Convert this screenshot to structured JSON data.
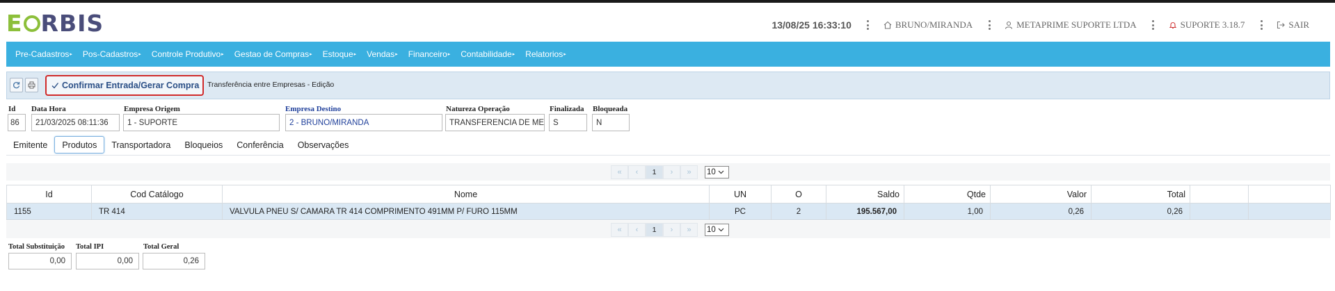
{
  "brand": {
    "logo_text": "EORBIS"
  },
  "header": {
    "datetime": "13/08/25 16:33:10",
    "branch": "BRUNO/MIRANDA",
    "company": "METAPRIME SUPORTE LTDA",
    "support": "SUPORTE 3.18.7",
    "logout": "SAIR"
  },
  "menu": [
    "Pre-Cadastros",
    "Pos-Cadastros",
    "Controle Produtivo",
    "Gestao de Compras",
    "Estoque",
    "Vendas",
    "Financeiro",
    "Contabilidade",
    "Relatorios"
  ],
  "toolbar": {
    "confirm_label": "Confirmar Entrada/Gerar Compra",
    "title": "Transferência entre Empresas - Edição"
  },
  "form": {
    "id": {
      "label": "Id",
      "value": "86"
    },
    "data_hora": {
      "label": "Data Hora",
      "value": "21/03/2025 08:11:36"
    },
    "empresa_origem": {
      "label": "Empresa Origem",
      "value": "1 - SUPORTE"
    },
    "empresa_destino": {
      "label": "Empresa Destino",
      "value": "2 - BRUNO/MIRANDA"
    },
    "natureza": {
      "label": "Natureza Operação",
      "value": "TRANSFERENCIA DE MERC"
    },
    "finalizada": {
      "label": "Finalizada",
      "value": "S"
    },
    "bloqueada": {
      "label": "Bloqueada",
      "value": "N"
    }
  },
  "tabs": [
    "Emitente",
    "Produtos",
    "Transportadora",
    "Bloqueios",
    "Conferência",
    "Observações"
  ],
  "active_tab": "Produtos",
  "pager": {
    "first": "«",
    "prev": "‹",
    "page": "1",
    "next": "›",
    "last": "»",
    "page_size": "10"
  },
  "table": {
    "columns": [
      "Id",
      "Cod Catálogo",
      "Nome",
      "UN",
      "O",
      "Saldo",
      "Qtde",
      "Valor",
      "Total",
      "",
      ""
    ],
    "rows": [
      [
        "1155",
        "TR 414",
        "VALVULA PNEU S/ CAMARA TR 414 COMPRIMENTO 491MM P/ FURO 115MM",
        "PC",
        "2",
        "195.567,00",
        "1,00",
        "0,26",
        "0,26",
        "",
        ""
      ]
    ]
  },
  "totals": {
    "substituicao": {
      "label": "Total Substituição",
      "value": "0,00"
    },
    "ipi": {
      "label": "Total IPI",
      "value": "0,00"
    },
    "geral": {
      "label": "Total Geral",
      "value": "0,26"
    }
  },
  "colors": {
    "menu_bar": "#3ab0e0",
    "confirm_border": "#d02a2a",
    "saldo": "#1b69b3",
    "row_selected": "#dae8f4"
  }
}
